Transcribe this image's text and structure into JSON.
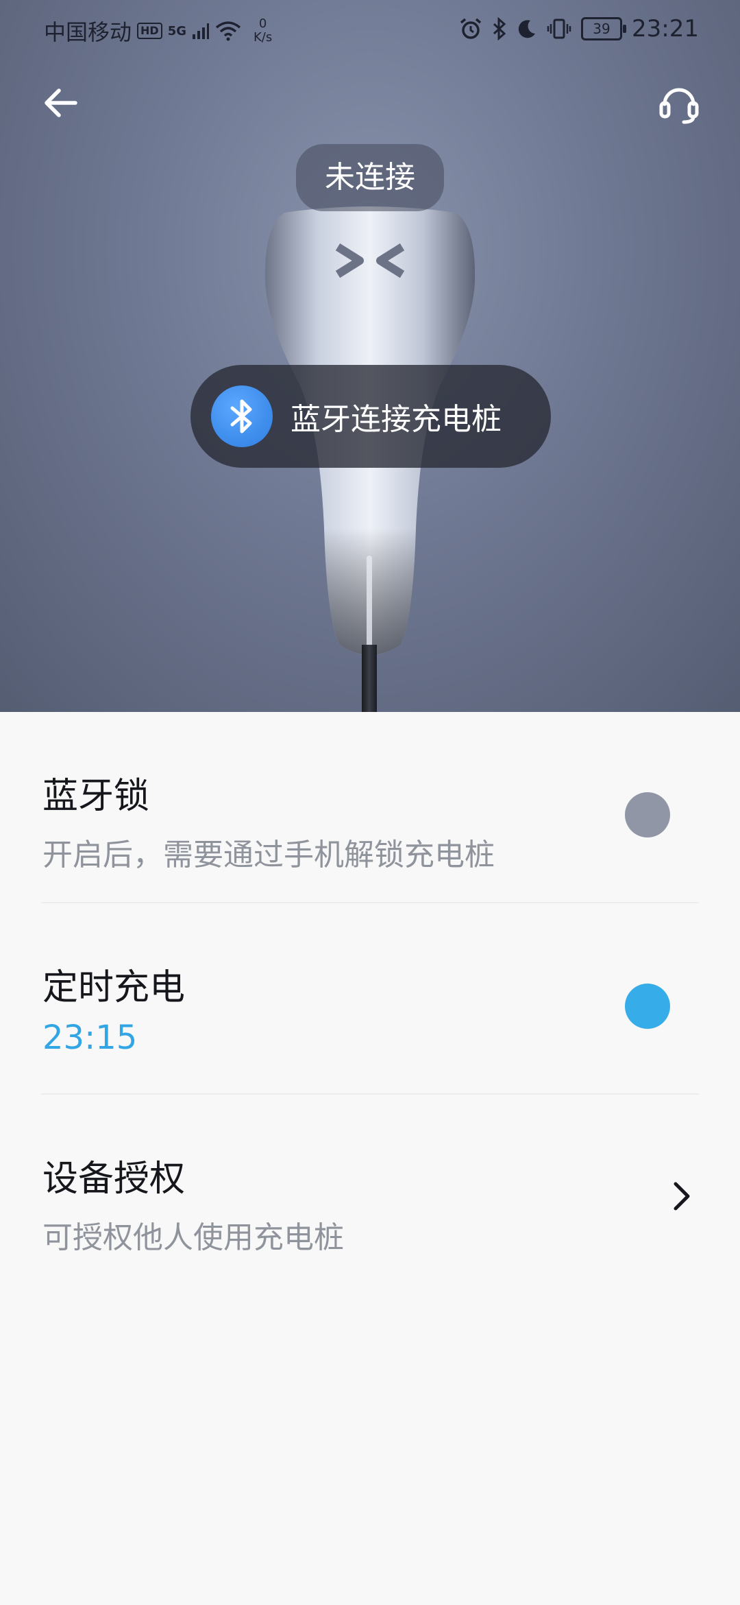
{
  "status_bar": {
    "carrier": "中国移动",
    "hd": "HD",
    "network": "5G",
    "speed_value": "0",
    "speed_unit": "K/s",
    "battery": "39",
    "time": "23:21"
  },
  "hero": {
    "connection_status": "未连接",
    "bluetooth_button": "蓝牙连接充电桩"
  },
  "settings": [
    {
      "title": "蓝牙锁",
      "subtitle": "开启后，需要通过手机解锁充电桩",
      "control": "toggle",
      "state": "off"
    },
    {
      "title": "定时充电",
      "subtitle": "23:15",
      "control": "toggle",
      "state": "on"
    },
    {
      "title": "设备授权",
      "subtitle": "可授权他人使用充电桩",
      "control": "chevron"
    }
  ],
  "colors": {
    "accent": "#36ade9",
    "toggle_off": "#9096a6",
    "bluetooth": "#2f7de0"
  },
  "icons": {
    "back": "arrow-left-icon",
    "support": "headset-icon",
    "bluetooth": "bluetooth-icon",
    "chevron": "chevron-right-icon"
  }
}
